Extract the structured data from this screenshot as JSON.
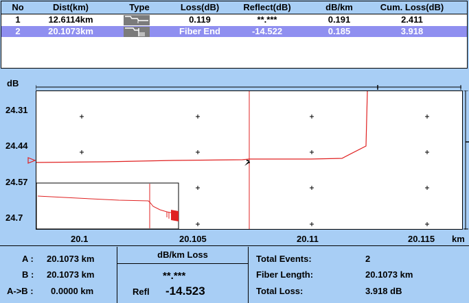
{
  "table": {
    "headers": [
      "No",
      "Dist(km)",
      "Type",
      "Loss(dB)",
      "Reflect(dB)",
      "dB/km",
      "Cum. Loss(dB)"
    ],
    "rows": [
      {
        "no": "1",
        "dist": "12.6114km",
        "type_icon": "splice-event-icon",
        "loss": "0.119",
        "reflect": "**.***",
        "dbkm": "0.191",
        "cum": "2.411"
      },
      {
        "no": "2",
        "dist": "20.1073km",
        "type_icon": "fiber-end-icon",
        "loss": "Fiber End",
        "reflect": "-14.522",
        "dbkm": "0.185",
        "cum": "3.918"
      }
    ],
    "selected_row": 2
  },
  "graph": {
    "y_unit": "dB",
    "x_unit": "km",
    "y_ticks": [
      "24.31",
      "24.44",
      "24.57",
      "24.7"
    ],
    "x_ticks": [
      "20.1",
      "20.105",
      "20.11",
      "20.115"
    ],
    "trace_color": "#e02020"
  },
  "info": {
    "a_label": "A :",
    "a_value": "20.1073 km",
    "b_label": "B :",
    "b_value": "20.1073 km",
    "ab_label": "A->B :",
    "ab_value": "0.0000 km",
    "loss_title": "dB/km Loss",
    "loss_value": "**.***",
    "refl_label": "Refl",
    "refl_value": "-14.523",
    "total_events_label": "Total Events:",
    "total_events_value": "2",
    "fiber_length_label": "Fiber Length:",
    "fiber_length_value": "20.1073 km",
    "total_loss_label": "Total Loss:",
    "total_loss_value": "3.918 dB"
  }
}
